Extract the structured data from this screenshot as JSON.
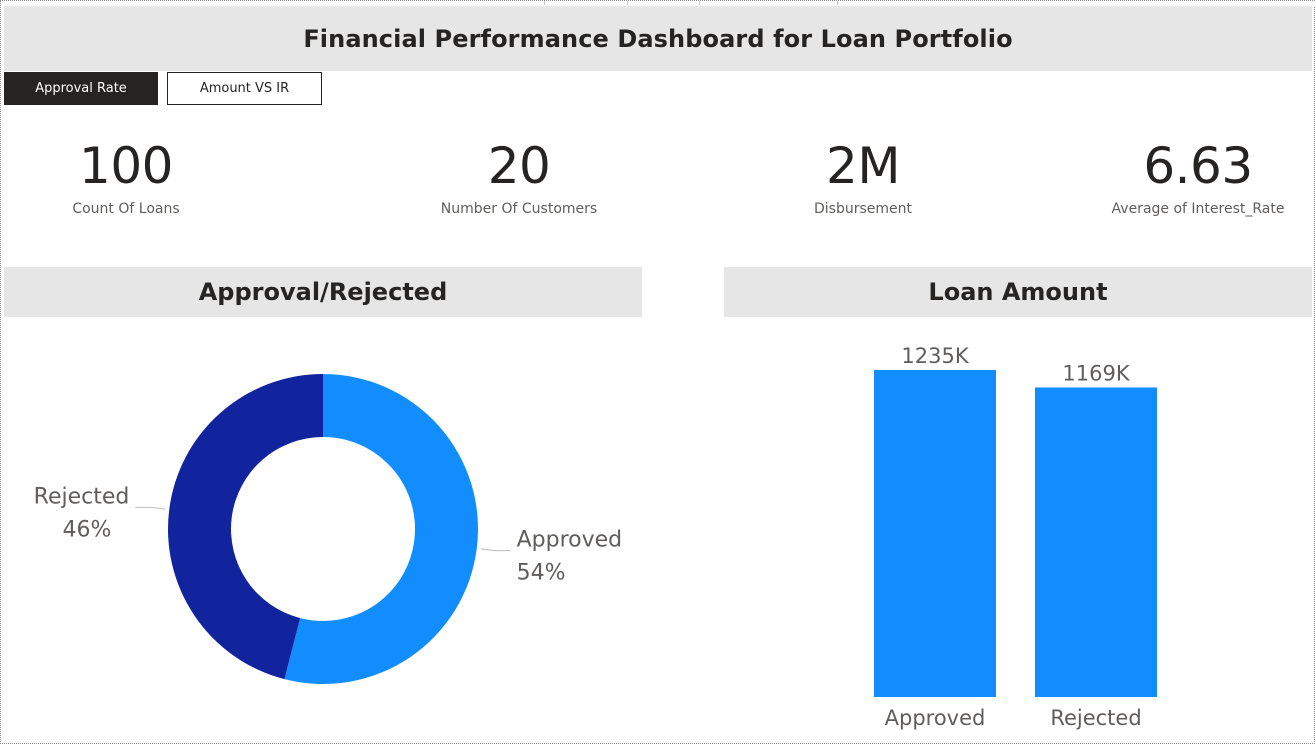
{
  "dashboard": {
    "title": "Financial Performance Dashboard for Loan Portfolio"
  },
  "nav": {
    "buttons": [
      {
        "label": "Approval Rate",
        "active": true
      },
      {
        "label": "Amount VS IR",
        "active": false
      }
    ]
  },
  "kpis": [
    {
      "value": "100",
      "label": "Count Of Loans"
    },
    {
      "value": "20",
      "label": "Number Of Customers"
    },
    {
      "value": "2M",
      "label": "Disbursement"
    },
    {
      "value": "6.63",
      "label": "Average of Interest_Rate"
    }
  ],
  "sections": {
    "approval_title": "Approval/Rejected",
    "amount_title": "Loan Amount"
  },
  "colors": {
    "approved": "#118dff",
    "rejected": "#12239e",
    "bar": "#118dff",
    "header_bg": "#e6e6e6",
    "active_button_bg": "#252423"
  },
  "chart_data": [
    {
      "type": "pie",
      "variant": "donut",
      "title": "Approval/Rejected",
      "slices": [
        {
          "label": "Approved",
          "value": 54,
          "display": "54%",
          "color": "#118dff"
        },
        {
          "label": "Rejected",
          "value": 46,
          "display": "46%",
          "color": "#12239e"
        }
      ]
    },
    {
      "type": "bar",
      "title": "Loan Amount",
      "categories": [
        "Approved",
        "Rejected"
      ],
      "values": [
        1235,
        1169
      ],
      "value_labels": [
        "1235K",
        "1169K"
      ],
      "unit": "K",
      "color": "#118dff",
      "ylim": [
        0,
        1235
      ]
    }
  ]
}
